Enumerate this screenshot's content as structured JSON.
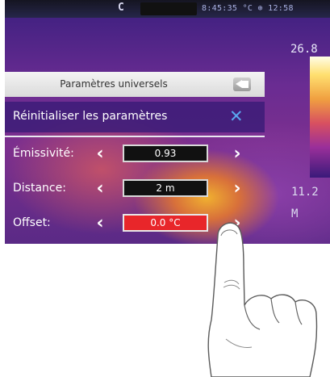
{
  "status_bar": {
    "icon": "camera-mode-icon",
    "text": "8:45:35  °C  ⊕  12:58"
  },
  "scale": {
    "max_temp": "26.8",
    "min_temp_line1": "11.2",
    "min_temp_line2": "M"
  },
  "menu": {
    "title": "Paramètres universels",
    "reset_label": "Réinitialiser les paramètres",
    "params": [
      {
        "label": "Émissivité:",
        "value": "0.93",
        "highlighted": false
      },
      {
        "label": "Distance:",
        "value": "2 m",
        "highlighted": false
      },
      {
        "label": "Offset:",
        "value": "0.0 °C",
        "highlighted": true
      }
    ]
  },
  "glyphs": {
    "chevron_left": "‹",
    "chevron_right": "›",
    "close": "✕",
    "camera": "C"
  },
  "colors": {
    "accent_blue": "#5aa8f0",
    "selected_red": "#e8262a",
    "menu_purple": "#3c1c78"
  }
}
